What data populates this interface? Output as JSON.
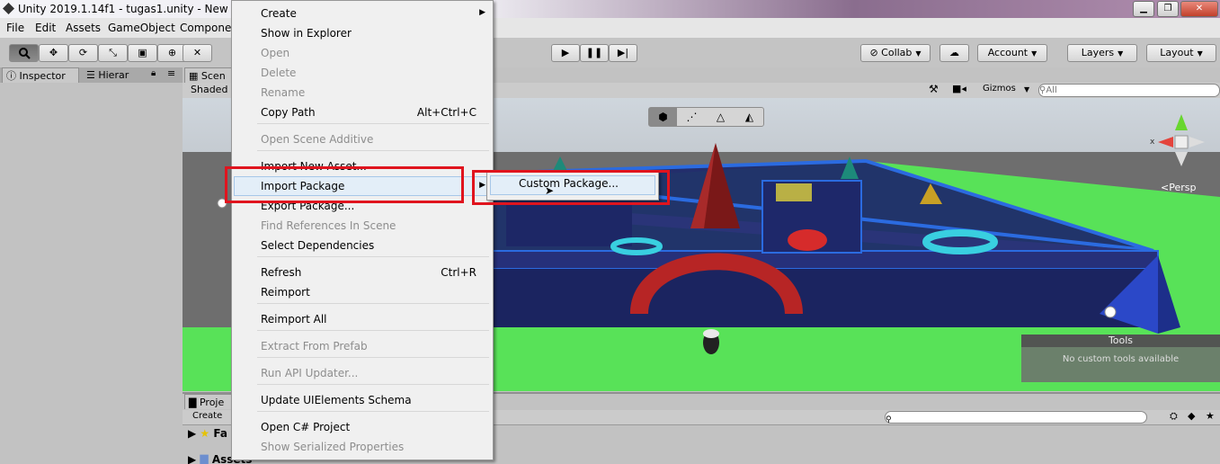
{
  "window": {
    "title": "Unity 2019.1.14f1 - tugas1.unity - New Unity",
    "buttons": {
      "minimize": "▁",
      "maximize": "❐",
      "close": "✕"
    }
  },
  "menubar": [
    "File",
    "Edit",
    "Assets",
    "GameObject",
    "Componen"
  ],
  "toolbar": {
    "collab": "Collab",
    "account": "Account",
    "layers": "Layers",
    "layout": "Layout"
  },
  "tabs": {
    "inspector": "Inspector",
    "hierarchy": "Hierar",
    "scene": "Scen",
    "shaded": "Shaded",
    "project": "Proje",
    "create": "Create",
    "favorites": "Fa",
    "assets": "Assets"
  },
  "scene": {
    "gizmos": "Gizmos",
    "search_placeholder": "All",
    "persp": "Persp",
    "gizmo_x": "x",
    "tools_title": "Tools",
    "tools_msg": "No custom tools available"
  },
  "context_menu": {
    "items": [
      {
        "label": "Create",
        "shortcut": "",
        "disabled": false
      },
      {
        "label": "Show in Explorer",
        "shortcut": "",
        "disabled": false
      },
      {
        "label": "Open",
        "shortcut": "",
        "disabled": true
      },
      {
        "label": "Delete",
        "shortcut": "",
        "disabled": true
      },
      {
        "label": "Rename",
        "shortcut": "",
        "disabled": true
      },
      {
        "label": "Copy Path",
        "shortcut": "Alt+Ctrl+C",
        "disabled": false
      },
      {
        "label": "Open Scene Additive",
        "shortcut": "",
        "disabled": true
      },
      {
        "label": "Import New Asset...",
        "shortcut": "",
        "disabled": false
      },
      {
        "label": "Import Package",
        "shortcut": "",
        "disabled": false
      },
      {
        "label": "Export Package...",
        "shortcut": "",
        "disabled": false
      },
      {
        "label": "Find References In Scene",
        "shortcut": "",
        "disabled": true
      },
      {
        "label": "Select Dependencies",
        "shortcut": "",
        "disabled": false
      },
      {
        "label": "Refresh",
        "shortcut": "Ctrl+R",
        "disabled": false
      },
      {
        "label": "Reimport",
        "shortcut": "",
        "disabled": false
      },
      {
        "label": "Reimport All",
        "shortcut": "",
        "disabled": false
      },
      {
        "label": "Extract From Prefab",
        "shortcut": "",
        "disabled": true
      },
      {
        "label": "Run API Updater...",
        "shortcut": "",
        "disabled": true
      },
      {
        "label": "Update UIElements Schema",
        "shortcut": "",
        "disabled": false
      },
      {
        "label": "Open C# Project",
        "shortcut": "",
        "disabled": false
      },
      {
        "label": "Show Serialized Properties",
        "shortcut": "",
        "disabled": true
      }
    ],
    "submenu": {
      "label": "Custom Package..."
    }
  }
}
